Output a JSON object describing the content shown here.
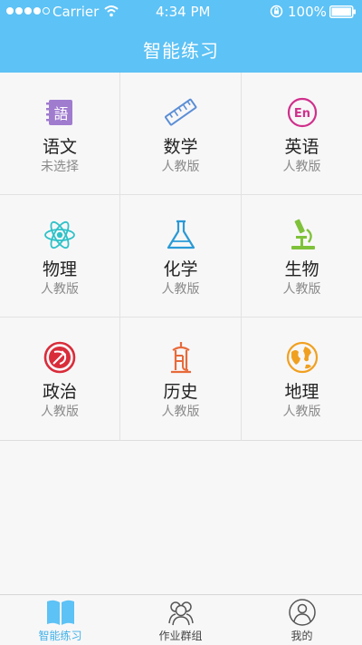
{
  "status_bar": {
    "carrier": "Carrier",
    "time": "4:34 PM",
    "battery": "100%"
  },
  "header": {
    "title": "智能练习"
  },
  "subjects": [
    {
      "name": "语文",
      "edition": "未选择",
      "icon": "chinese-book-icon",
      "color": "#a07ccf"
    },
    {
      "name": "数学",
      "edition": "人教版",
      "icon": "ruler-icon",
      "color": "#5b8fd6"
    },
    {
      "name": "英语",
      "edition": "人教版",
      "icon": "english-en-icon",
      "color": "#d0308c"
    },
    {
      "name": "物理",
      "edition": "人教版",
      "icon": "atom-icon",
      "color": "#2ec2c8"
    },
    {
      "name": "化学",
      "edition": "人教版",
      "icon": "flask-icon",
      "color": "#2a9ad6"
    },
    {
      "name": "生物",
      "edition": "人教版",
      "icon": "microscope-icon",
      "color": "#7fc23a"
    },
    {
      "name": "政治",
      "edition": "人教版",
      "icon": "hammer-sickle-icon",
      "color": "#d92d3a"
    },
    {
      "name": "历史",
      "edition": "人教版",
      "icon": "pagoda-icon",
      "color": "#e76a3a"
    },
    {
      "name": "地理",
      "edition": "人教版",
      "icon": "globe-icon",
      "color": "#f0a020"
    }
  ],
  "tabbar": {
    "items": [
      {
        "label": "智能练习",
        "icon": "book-icon",
        "active": true
      },
      {
        "label": "作业群组",
        "icon": "group-icon",
        "active": false
      },
      {
        "label": "我的",
        "icon": "profile-icon",
        "active": false
      }
    ],
    "active_color": "#3fb1e8"
  }
}
